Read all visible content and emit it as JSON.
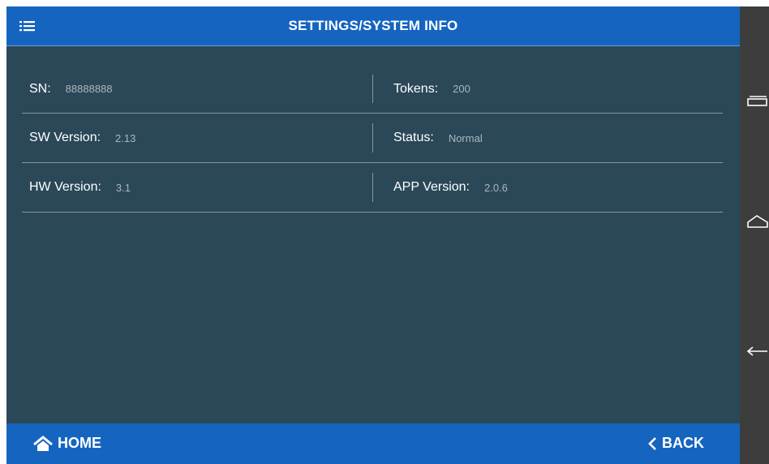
{
  "header": {
    "title": "SETTINGS/SYSTEM INFO",
    "menu_icon": "hamburger-menu-icon"
  },
  "info": {
    "rows": [
      {
        "left": {
          "label": "SN:",
          "value": "88888888"
        },
        "right": {
          "label": "Tokens:",
          "value": "200"
        }
      },
      {
        "left": {
          "label": "SW Version:",
          "value": "2.13"
        },
        "right": {
          "label": "Status:",
          "value": "Normal"
        }
      },
      {
        "left": {
          "label": "HW Version:",
          "value": "3.1"
        },
        "right": {
          "label": "APP Version:",
          "value": "2.0.6"
        }
      }
    ]
  },
  "footer": {
    "home_label": "HOME",
    "back_label": "BACK",
    "home_icon": "home-icon",
    "back_icon": "chevron-left-icon"
  },
  "system_nav": {
    "icons": [
      "recent-apps-icon",
      "home-nav-icon",
      "back-nav-icon"
    ]
  },
  "colors": {
    "accent": "#1565c0",
    "background": "#2b4858",
    "divider": "#8196a2",
    "label": "#ffffff",
    "value": "#aab6bd",
    "nav_bar": "#3d3d3d"
  }
}
